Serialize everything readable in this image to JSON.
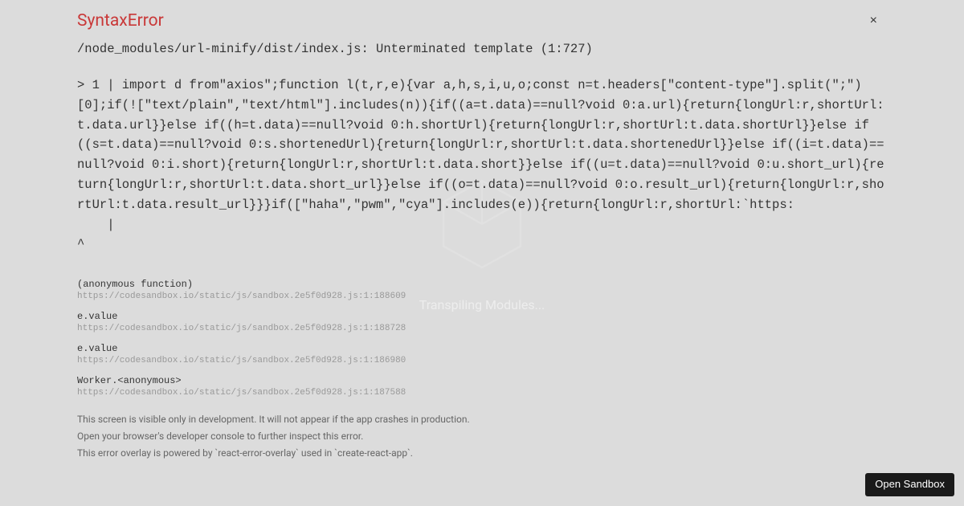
{
  "background": {
    "status_text": "Transpiling Modules..."
  },
  "error": {
    "title": "SyntaxError",
    "close_label": "×",
    "location": "/node_modules/url-minify/dist/index.js: Unterminated template (1:727)",
    "code": "> 1 | import d from\"axios\";function l(t,r,e){var a,h,s,i,u,o;const n=t.headers[\"content-type\"].split(\";\")[0];if(![\"text/plain\",\"text/html\"].includes(n)){if((a=t.data)==null?void 0:a.url){return{longUrl:r,shortUrl:t.data.url}}else if((h=t.data)==null?void 0:h.shortUrl){return{longUrl:r,shortUrl:t.data.shortUrl}}else if((s=t.data)==null?void 0:s.shortenedUrl){return{longUrl:r,shortUrl:t.data.shortenedUrl}}else if((i=t.data)==null?void 0:i.short){return{longUrl:r,shortUrl:t.data.short}}else if((u=t.data)==null?void 0:u.short_url){return{longUrl:r,shortUrl:t.data.short_url}}else if((o=t.data)==null?void 0:o.result_url){return{longUrl:r,shortUrl:t.data.result_url}}}if([\"haha\",\"pwm\",\"cya\"].includes(e)){return{longUrl:r,shortUrl:`https:\n    | \n^"
  },
  "stack": [
    {
      "name": "(anonymous function)",
      "url": "https://codesandbox.io/static/js/sandbox.2e5f0d928.js:1:188609"
    },
    {
      "name": "e.value",
      "url": "https://codesandbox.io/static/js/sandbox.2e5f0d928.js:1:188728"
    },
    {
      "name": "e.value",
      "url": "https://codesandbox.io/static/js/sandbox.2e5f0d928.js:1:186980"
    },
    {
      "name": "Worker.<anonymous>",
      "url": "https://codesandbox.io/static/js/sandbox.2e5f0d928.js:1:187588"
    }
  ],
  "footer": {
    "line1": "This screen is visible only in development. It will not appear if the app crashes in production.",
    "line2": "Open your browser's developer console to further inspect this error.",
    "line3": "This error overlay is powered by `react-error-overlay` used in `create-react-app`."
  },
  "sandbox_button": {
    "label": "Open Sandbox"
  }
}
